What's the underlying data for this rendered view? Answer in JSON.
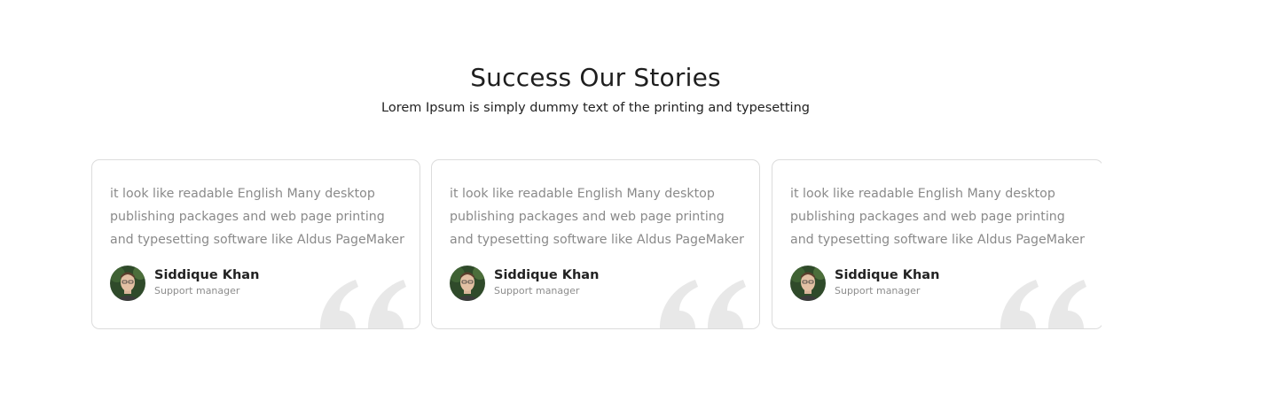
{
  "section": {
    "title": "Success Our Stories",
    "subtitle": "Lorem Ipsum is simply dummy text of the printing and typesetting"
  },
  "testimonials": [
    {
      "text": "it look like readable English Many desktop publishing packages and web page printing and typesetting software like Aldus PageMaker",
      "name": "Siddique Khan",
      "role": "Support manager"
    },
    {
      "text": "it look like readable English Many desktop publishing packages and web page printing and typesetting software like Aldus PageMaker",
      "name": "Siddique Khan",
      "role": "Support manager"
    },
    {
      "text": "it look like readable English Many desktop publishing packages and web page printing and typesetting software like Aldus PageMaker",
      "name": "Siddique Khan",
      "role": "Support manager"
    }
  ],
  "icons": {
    "avatar": "avatar-photo",
    "quote": "quote-icon"
  },
  "colors": {
    "quote_mark": "#e8e8e8",
    "card_border": "#dcdcdc",
    "text_muted": "#8a8a8a"
  }
}
